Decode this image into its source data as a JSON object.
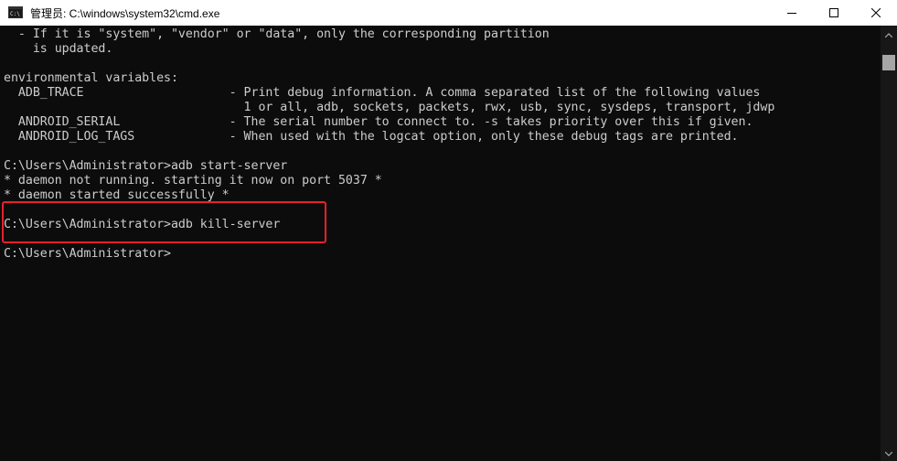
{
  "window": {
    "title": "管理员: C:\\windows\\system32\\cmd.exe"
  },
  "console": {
    "lines": [
      "  - If it is \"system\", \"vendor\" or \"data\", only the corresponding partition",
      "    is updated.",
      "",
      "environmental variables:",
      "  ADB_TRACE                    - Print debug information. A comma separated list of the following values",
      "                                 1 or all, adb, sockets, packets, rwx, usb, sync, sysdeps, transport, jdwp",
      "  ANDROID_SERIAL               - The serial number to connect to. -s takes priority over this if given.",
      "  ANDROID_LOG_TAGS             - When used with the logcat option, only these debug tags are printed.",
      "",
      "C:\\Users\\Administrator>adb start-server",
      "* daemon not running. starting it now on port 5037 *",
      "* daemon started successfully *",
      "",
      "C:\\Users\\Administrator>adb kill-server",
      "",
      "C:\\Users\\Administrator>"
    ]
  },
  "colors": {
    "background": "#0c0c0c",
    "text": "#cccccc",
    "highlight": "#e8202a",
    "titlebar": "#ffffff"
  },
  "icons": {
    "app": "cmd-app-icon",
    "minimize": "minimize-icon",
    "maximize": "maximize-icon",
    "close": "close-icon",
    "scroll_up": "chevron-up-icon",
    "scroll_down": "chevron-down-icon"
  }
}
